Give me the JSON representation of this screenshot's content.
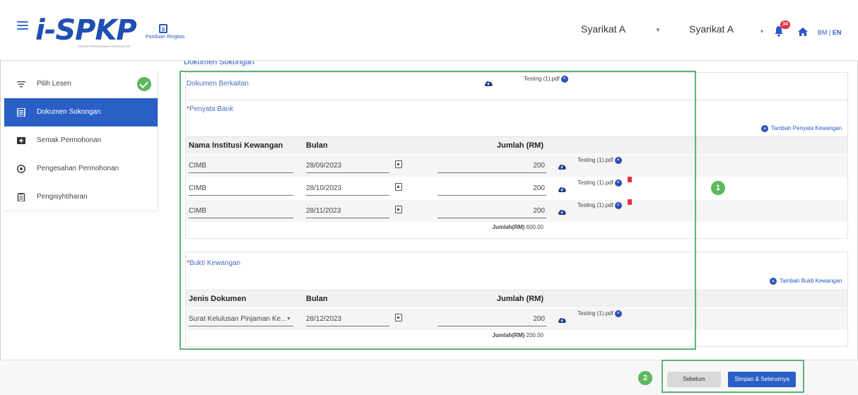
{
  "header": {
    "logo_text": "i-SPKP",
    "logo_subtitle": "SISTEM PERMOHONAN KONTRAKTOR",
    "panduan_label": "Panduan Ringkas",
    "company_select": "Syarikat A",
    "company_name": "Syarikat A",
    "notification_count": "34",
    "lang_bm": "BM",
    "lang_sep": "|",
    "lang_en": "EN"
  },
  "sidebar": {
    "items": [
      {
        "label": "Pilih Lesen",
        "icon": "filter-icon",
        "done": true
      },
      {
        "label": "Dokumen Sokongan",
        "icon": "document-icon",
        "active": true
      },
      {
        "label": "Semak Permohonan",
        "icon": "review-icon"
      },
      {
        "label": "Pengesahan Permohonan",
        "icon": "verify-icon"
      },
      {
        "label": "Pengisyhtiharan",
        "icon": "clipboard-icon"
      }
    ]
  },
  "main": {
    "heading": "Dokumen Sokongan",
    "dokumen_berkaitan": {
      "label": "Dokumen Berkaitan",
      "file": "Testing (1).pdf"
    },
    "penyata_bank": {
      "label": "Penyata Bank",
      "add_label": "Tambah Penyata Kewangan",
      "columns": {
        "institusi": "Nama Institusi Kewangan",
        "bulan": "Bulan",
        "jumlah": "Jumlah (RM)"
      },
      "rows": [
        {
          "institusi": "CIMB",
          "bulan": "28/09/2023",
          "jumlah": "200",
          "file": "Testing (1).pdf"
        },
        {
          "institusi": "CIMB",
          "bulan": "28/10/2023",
          "jumlah": "200",
          "file": "Testing (1).pdf"
        },
        {
          "institusi": "CIMB",
          "bulan": "28/11/2023",
          "jumlah": "200",
          "file": "Testing (1).pdf"
        }
      ],
      "total_label": "Jumlah(RM)",
      "total_value": "600.00"
    },
    "bukti_kewangan": {
      "label": "Bukti Kewangan",
      "add_label": "Tambah Bukti Kewangan",
      "columns": {
        "jenis": "Jenis Dokumen",
        "bulan": "Bulan",
        "jumlah": "Jumlah (RM)"
      },
      "rows": [
        {
          "jenis": "Surat Kelulusan Pinjaman Ke...",
          "bulan": "28/12/2023",
          "jumlah": "200",
          "file": "Testing (1).pdf"
        }
      ],
      "total_label": "Jumlah(RM)",
      "total_value": "200.00"
    }
  },
  "callouts": {
    "one": "1",
    "two": "2"
  },
  "footer": {
    "prev_label": "Sebelum",
    "next_label": "Simpan & Seterusnya"
  },
  "colors": {
    "primary": "#2a5fc6",
    "accent_green": "#5cb85c",
    "danger": "#e5323b"
  }
}
